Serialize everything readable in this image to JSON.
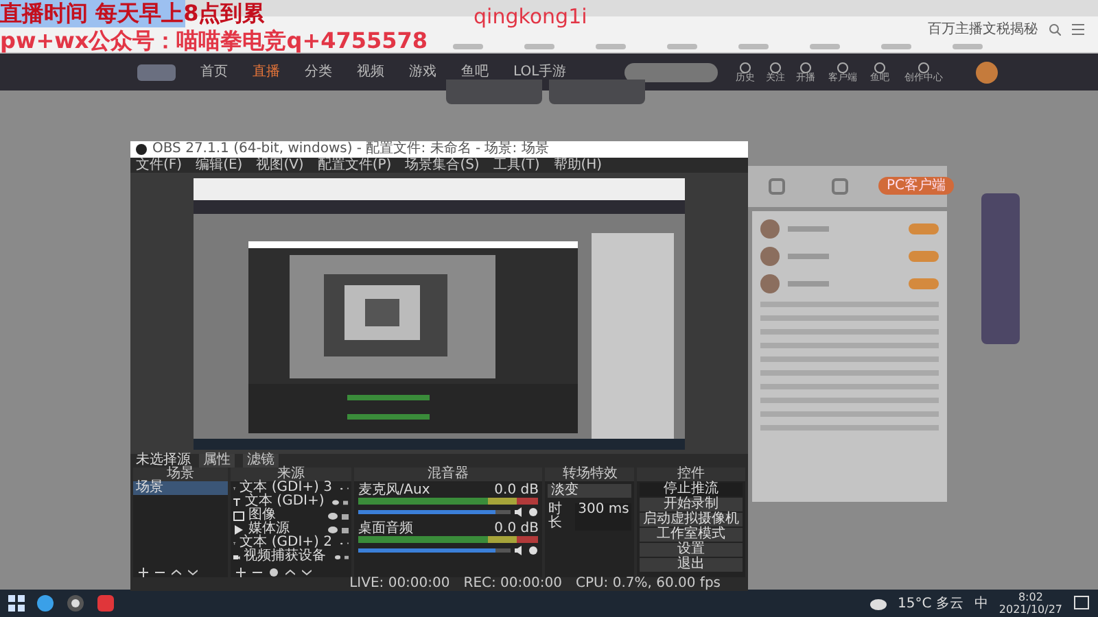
{
  "overlay": {
    "lines": [
      "直播时间 每天早上8点到累",
      "pw+wx公众号：喵喵拳电竞q+4755578"
    ],
    "tag": "qingkong1i"
  },
  "browser": {
    "search_hint": "百万主播文税揭秘"
  },
  "site": {
    "nav": [
      {
        "label": "首页",
        "selected": false
      },
      {
        "label": "直播",
        "selected": true
      },
      {
        "label": "分类",
        "selected": false
      },
      {
        "label": "视频",
        "selected": false
      },
      {
        "label": "游戏",
        "selected": false
      },
      {
        "label": "鱼吧",
        "selected": false
      },
      {
        "label": "LOL手游",
        "selected": false
      }
    ],
    "header_icons": [
      "历史",
      "关注",
      "开播",
      "客户端",
      "鱼吧",
      "创作中心"
    ],
    "client_button": "PC客户端"
  },
  "obs": {
    "title": "OBS 27.1.1 (64-bit, windows) - 配置文件: 未命名 - 场景: 场景",
    "menu": [
      "文件(F)",
      "编辑(E)",
      "视图(V)",
      "配置文件(P)",
      "场景集合(S)",
      "工具(T)",
      "帮助(H)"
    ],
    "source_label": "未选择源",
    "source_buttons": [
      "属性",
      "滤镜"
    ],
    "docks": [
      "场景",
      "来源",
      "混音器",
      "转场特效",
      "控件"
    ],
    "scenes": [
      {
        "name": "场景",
        "selected": true
      }
    ],
    "sources": [
      {
        "kind": "text",
        "name": "文本 (GDI+) 3"
      },
      {
        "kind": "text",
        "name": "文本 (GDI+)"
      },
      {
        "kind": "image",
        "name": "图像"
      },
      {
        "kind": "media",
        "name": "媒体源"
      },
      {
        "kind": "text",
        "name": "文本 (GDI+) 2"
      },
      {
        "kind": "camera",
        "name": "视频捕获设备"
      }
    ],
    "mixer": [
      {
        "name": "麦克风/Aux",
        "reading": "0.0 dB",
        "level": 0.9
      },
      {
        "name": "桌面音频",
        "reading": "0.0 dB",
        "level": 0.9
      }
    ],
    "transition": {
      "value": "淡变",
      "duration_label": "时长",
      "duration": "300 ms"
    },
    "controls": [
      {
        "label": "停止推流",
        "active": true
      },
      {
        "label": "开始录制",
        "active": false
      },
      {
        "label": "启动虚拟摄像机",
        "active": false
      },
      {
        "label": "工作室模式",
        "active": false
      },
      {
        "label": "设置",
        "active": false
      },
      {
        "label": "退出",
        "active": false
      }
    ],
    "status": [
      "LIVE: 00:00:00",
      "REC: 00:00:00",
      "CPU: 0.7%, 60.00 fps"
    ]
  },
  "taskbar": {
    "weather": "15°C 多云",
    "ime": "中",
    "time": "8:02",
    "date": "2021/10/27"
  }
}
